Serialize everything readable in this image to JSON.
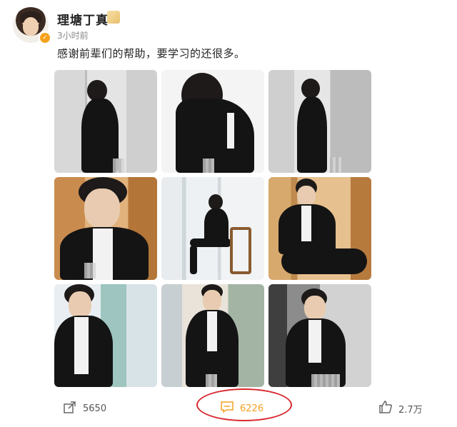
{
  "post": {
    "username": "理塘丁真",
    "timestamp": "3小时前",
    "text": "感谢前辈们的帮助，要学习的还很多。"
  },
  "photos": [
    "photo-1",
    "photo-2",
    "photo-3",
    "photo-4",
    "photo-5",
    "photo-6",
    "photo-7",
    "photo-8",
    "photo-9"
  ],
  "actions": {
    "share_count": "5650",
    "comment_count": "6226",
    "like_count": "2.7万"
  },
  "colors": {
    "comment_accent": "#f4a020",
    "highlight_ring": "#d9272e"
  },
  "icons": {
    "share": "share-icon",
    "comment": "comment-icon",
    "like": "thumbs-up-icon"
  }
}
